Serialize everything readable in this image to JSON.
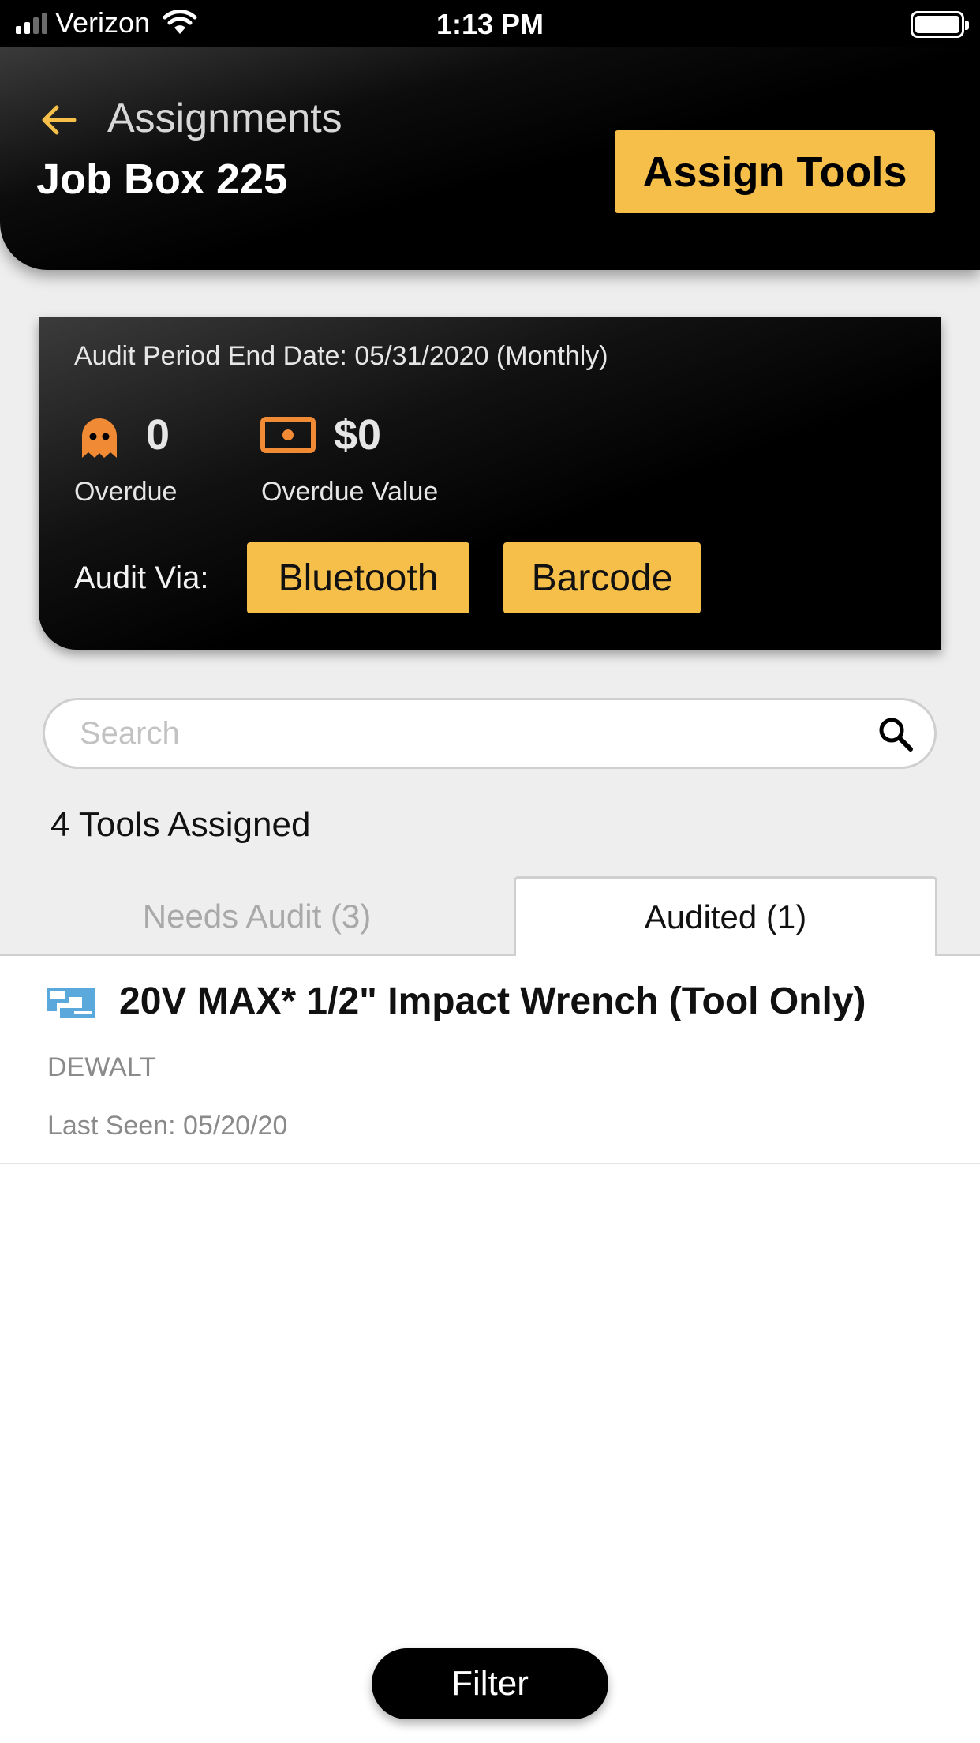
{
  "status_bar": {
    "carrier": "Verizon",
    "time": "1:13 PM"
  },
  "header": {
    "back_label": "Assignments",
    "title": "Job Box 225",
    "assign_button": "Assign Tools"
  },
  "audit": {
    "period_text": "Audit Period End Date: 05/31/2020 (Monthly)",
    "overdue_count": "0",
    "overdue_label": "Overdue",
    "overdue_value": "$0",
    "overdue_value_label": "Overdue Value",
    "audit_via_label": "Audit Via:",
    "bluetooth_button": "Bluetooth",
    "barcode_button": "Barcode"
  },
  "search": {
    "placeholder": "Search",
    "value": ""
  },
  "tools_count": "4 Tools Assigned",
  "tabs": [
    {
      "label": "Needs Audit (3)",
      "active": false
    },
    {
      "label": "Audited (1)",
      "active": true
    }
  ],
  "items": [
    {
      "name": "20V MAX* 1/2\" Impact Wrench (Tool Only)",
      "brand": "DEWALT",
      "last_seen": "Last Seen: 05/20/20",
      "icon": "tool-tag-icon"
    }
  ],
  "filter_button": "Filter",
  "colors": {
    "accent_yellow": "#f5bf4a",
    "accent_orange": "#f08a34",
    "tag_blue": "#5aa8dc"
  }
}
